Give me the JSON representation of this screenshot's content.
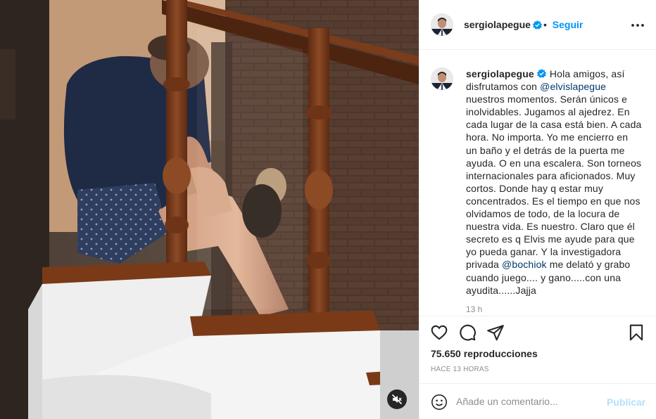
{
  "post": {
    "username": "sergiolapegue",
    "follow_separator": "•",
    "follow_label": "Seguir",
    "caption_part1": "Hola amigos, así disfrutamos con ",
    "mention1": "@elvislapegue",
    "caption_part2": " nuestros momentos. Serán únicos e inolvidables. Jugamos al ajedrez. En cada lugar de la casa está bien. A cada hora. No importa. Yo me encierro en un baño y el detrás de la puerta me ayuda. O en una escalera. Son torneos internacionales para aficionados. Muy cortos. Donde hay q estar muy concentrados. Es el tiempo en que nos olvidamos de todo, de la locura de nuestra vida. Es nuestro. Claro que él secreto es q Elvis me ayude para que yo pueda ganar. Y la investigadora privada ",
    "mention2": "@bochiok",
    "caption_part3": " me delató y grabo cuando juego.... y gano.....con una ayudita......Jajja",
    "comment_time": "13 h",
    "views": "75.650 reproducciones",
    "posted_ago": "Hace 13 horas"
  },
  "comment_box": {
    "placeholder": "Añade un comentario...",
    "publish_label": "Publicar"
  },
  "icons": {
    "verified": "verified-badge-icon",
    "more": "more-options-icon",
    "like": "heart-icon",
    "comment": "comment-bubble-icon",
    "share": "paper-plane-icon",
    "save": "bookmark-icon",
    "emoji": "emoji-icon",
    "mute": "speaker-muted-icon"
  },
  "colors": {
    "accent": "#0095f6",
    "mention": "#00376b",
    "muted_text": "#8e8e8e",
    "publish_disabled": "#b2dffc"
  }
}
